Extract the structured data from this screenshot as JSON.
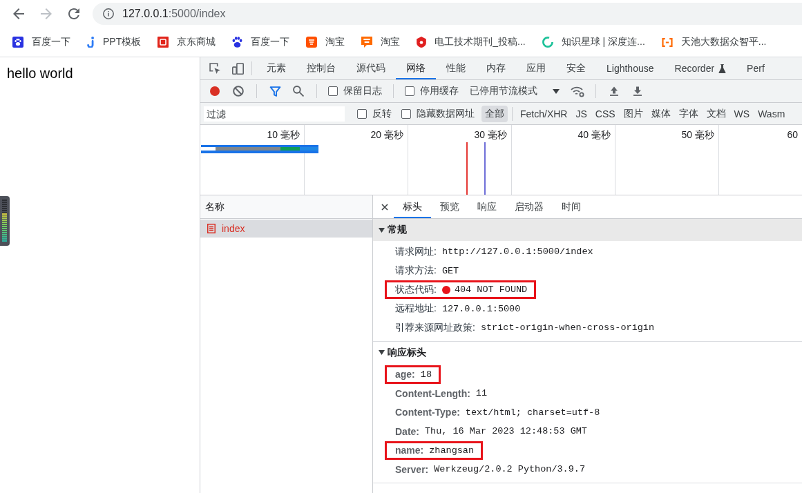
{
  "browser": {
    "nav": [
      {
        "kind": "back",
        "disabled": false
      },
      {
        "kind": "forward",
        "disabled": true
      },
      {
        "kind": "reload",
        "disabled": false
      }
    ],
    "address": {
      "host": "127.0.0.1",
      "path": ":5000/index"
    }
  },
  "bookmarks": [
    {
      "label": "百度一下",
      "kind": "paw-tile"
    },
    {
      "label": "PPT模板",
      "kind": "hook"
    },
    {
      "label": "京东商城",
      "kind": "square-tile"
    },
    {
      "label": "百度一下",
      "kind": "paw"
    },
    {
      "label": "淘宝",
      "kind": "tile"
    },
    {
      "label": "淘宝",
      "kind": "bubble"
    },
    {
      "label": "电工技术期刊_投稿...",
      "kind": "shield"
    },
    {
      "label": "知识星球 | 深度连...",
      "kind": "ring"
    },
    {
      "label": "天池大数据众智平...",
      "kind": "bracket"
    }
  ],
  "page": {
    "text": "hello world"
  },
  "volume_meter": {
    "level": 0.7
  },
  "devtools": {
    "tabs": [
      {
        "label": "元素",
        "selected": false
      },
      {
        "label": "控制台",
        "selected": false
      },
      {
        "label": "源代码",
        "selected": false
      },
      {
        "label": "网络",
        "selected": true
      },
      {
        "label": "性能",
        "selected": false
      },
      {
        "label": "内存",
        "selected": false
      },
      {
        "label": "应用",
        "selected": false
      },
      {
        "label": "安全",
        "selected": false
      },
      {
        "label": "Lighthouse",
        "selected": false
      },
      {
        "label": "Recorder",
        "selected": false,
        "kind": "experimental"
      },
      {
        "label": "Perf",
        "selected": false
      }
    ],
    "toolbar": {
      "recording": true,
      "filter_on": true,
      "checkboxes": [
        {
          "label": "保留日志",
          "checked": false
        },
        {
          "label": "停用缓存",
          "checked": false
        }
      ],
      "throttle": "已停用节流模式"
    },
    "filter": {
      "placeholder": "过滤",
      "checkboxes": [
        {
          "label": "反转",
          "checked": false
        },
        {
          "label": "隐藏数据网址",
          "checked": false
        }
      ],
      "types": [
        {
          "label": "全部",
          "selected": true
        },
        {
          "label": "Fetch/XHR",
          "selected": false
        },
        {
          "label": "JS",
          "selected": false
        },
        {
          "label": "CSS",
          "selected": false
        },
        {
          "label": "图片",
          "selected": false
        },
        {
          "label": "媒体",
          "selected": false
        },
        {
          "label": "字体",
          "selected": false
        },
        {
          "label": "文档",
          "selected": false
        },
        {
          "label": "WS",
          "selected": false
        },
        {
          "label": "Wasm",
          "selected": false
        }
      ]
    },
    "timeline": {
      "ticks": [
        "10 毫秒",
        "20 毫秒",
        "30 毫秒",
        "40 毫秒",
        "50 毫秒",
        "60"
      ]
    },
    "requests": {
      "column": "名称",
      "rows": [
        {
          "name": "index",
          "selected": true,
          "error": true
        }
      ]
    },
    "detail": {
      "tabs": [
        {
          "label": "标头",
          "selected": true
        },
        {
          "label": "预览",
          "selected": false
        },
        {
          "label": "响应",
          "selected": false
        },
        {
          "label": "启动器",
          "selected": false
        },
        {
          "label": "时间",
          "selected": false
        }
      ],
      "sections": [
        {
          "title": "常规",
          "kind": "general",
          "focused": true,
          "rows": [
            {
              "key": "请求网址:",
              "value": "http://127.0.0.1:5000/index",
              "highlighted": false
            },
            {
              "key": "请求方法:",
              "value": "GET",
              "highlighted": false
            },
            {
              "key": "状态代码:",
              "value": "404 NOT FOUND",
              "color": "#e8141b",
              "highlighted": true
            },
            {
              "key": "远程地址:",
              "value": "127.0.0.1:5000",
              "highlighted": false
            },
            {
              "key": "引荐来源网址政策:",
              "value": "strict-origin-when-cross-origin",
              "highlighted": false
            }
          ]
        },
        {
          "title": "响应标头",
          "kind": "headers",
          "focused": false,
          "rows": [
            {
              "key": "age:",
              "value": "18",
              "highlighted": true
            },
            {
              "key": "Content-Length:",
              "value": "11",
              "highlighted": false
            },
            {
              "key": "Content-Type:",
              "value": "text/html; charset=utf-8",
              "highlighted": false
            },
            {
              "key": "Date:",
              "value": "Thu, 16 Mar 2023 12:48:53 GMT",
              "highlighted": false
            },
            {
              "key": "name:",
              "value": "zhangsan",
              "highlighted": true
            },
            {
              "key": "Server:",
              "value": "Werkzeug/2.0.2 Python/3.9.7",
              "highlighted": false
            }
          ]
        }
      ]
    }
  }
}
